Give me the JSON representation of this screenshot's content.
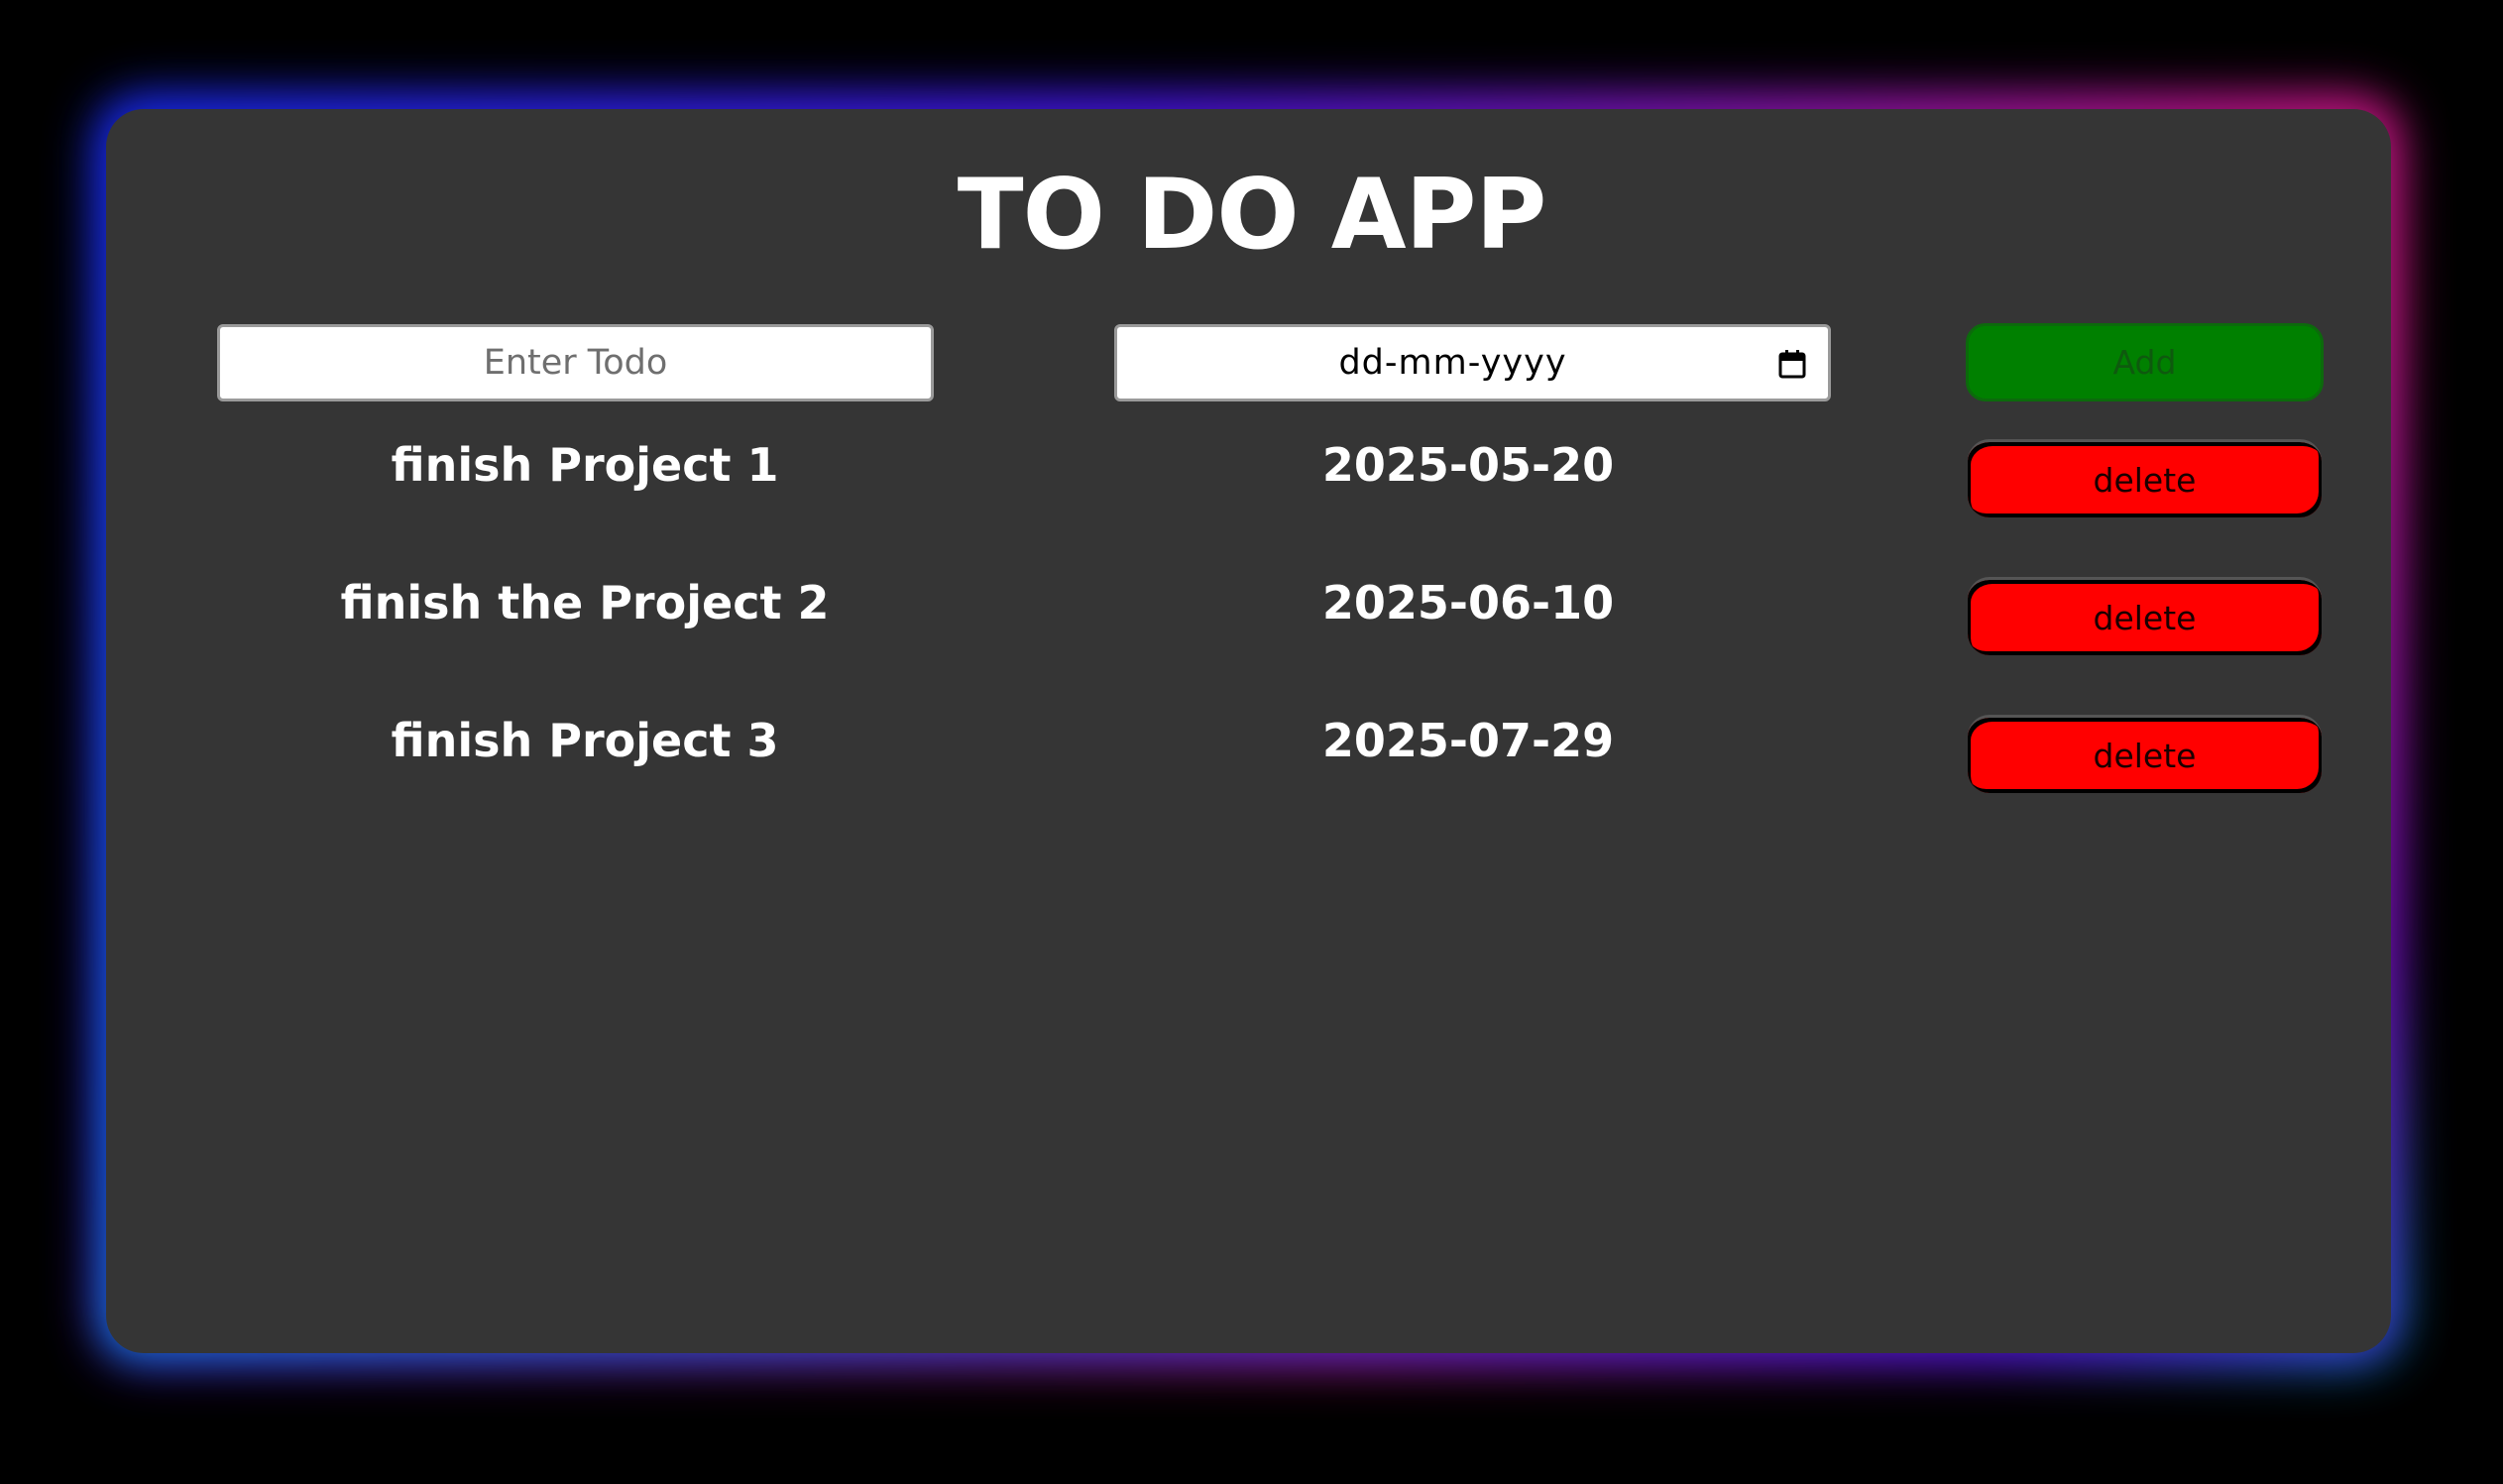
{
  "app": {
    "title": "TO DO APP"
  },
  "form": {
    "todo_placeholder": "Enter Todo",
    "date_placeholder": "dd-mm-yyyy",
    "add_label": "Add"
  },
  "todos": [
    {
      "name": "finish Project 1",
      "date": "2025-05-20",
      "delete_label": "delete"
    },
    {
      "name": "finish the Project 2",
      "date": "2025-06-10",
      "delete_label": "delete"
    },
    {
      "name": "finish Project 3",
      "date": "2025-07-29",
      "delete_label": "delete"
    }
  ],
  "colors": {
    "background": "#000000",
    "card": "#353535",
    "add_button": "#008000",
    "delete_button": "#ff0000",
    "glow_blue": "#1a2cff",
    "glow_pink": "#e01a8a",
    "glow_cyan": "#00b8ff"
  },
  "icons": {
    "date_picker": "calendar-icon"
  }
}
